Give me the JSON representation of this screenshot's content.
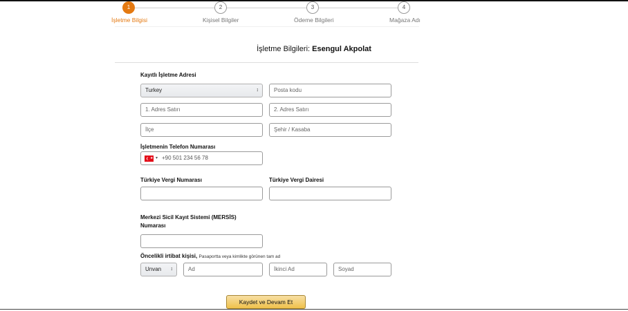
{
  "stepper": {
    "steps": [
      {
        "number": "1",
        "label": "İşletme Bilgisi",
        "active": true
      },
      {
        "number": "2",
        "label": "Kişisel Bilgiler",
        "active": false
      },
      {
        "number": "3",
        "label": "Ödeme Bilgileri",
        "active": false
      },
      {
        "number": "4",
        "label": "Mağaza Adı",
        "active": false
      }
    ],
    "active_color": "#e47911"
  },
  "header": {
    "title_prefix": "İşletme Bilgileri:",
    "title_name": "Esengul Akpolat"
  },
  "address": {
    "label": "Kayıtlı İşletme Adresi",
    "country": "Turkey",
    "postal_placeholder": "Posta kodu",
    "address1_placeholder": "1. Adres Satırı",
    "address2_placeholder": "2. Adres Satırı",
    "district_placeholder": "İlçe",
    "city_placeholder": "Şehir / Kasaba"
  },
  "phone": {
    "label": "İşletmenin Telefon Numarası",
    "flag_icon": "turkey-flag-icon",
    "placeholder": "+90 501 234 56 78"
  },
  "tax": {
    "number_label": "Türkiye Vergi Numarası",
    "office_label": "Türkiye Vergi Dairesi",
    "number_value": "",
    "office_value": ""
  },
  "mersis": {
    "label_line1": "Merkezi Sicil Kayıt Sistemi (MERSİS)",
    "label_line2": "Numarası",
    "value": ""
  },
  "contact": {
    "label": "Öncelikli irtibat kişisi,",
    "note": "Pasaportta veya kimlikte görünen tam ad",
    "title_select": "Unvan",
    "first_placeholder": "Ad",
    "middle_placeholder": "İkinci Ad",
    "last_placeholder": "Soyad"
  },
  "actions": {
    "submit_label": "Kaydet ve Devam Et",
    "submit_color": "#f0c14b"
  }
}
